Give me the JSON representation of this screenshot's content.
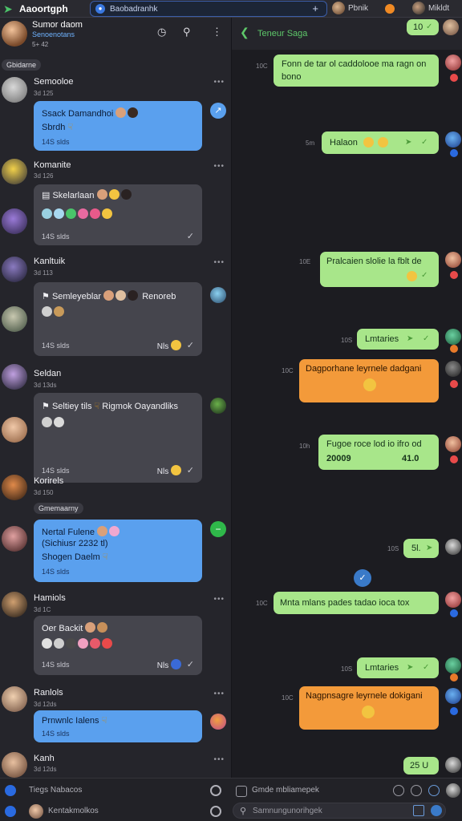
{
  "app": {
    "title": "Aaoortgph",
    "icon": "leaf-icon"
  },
  "tabs": {
    "main_label": "Baobadranhk",
    "plus": "+",
    "user1": "Pbnik",
    "user2": "Mikldt"
  },
  "left_header": {
    "name": "Sumor daom",
    "subtitle": "Senoenotans",
    "meta": "5+ 42"
  },
  "pills": {
    "p1": "Gbidarne",
    "p2": "Gmemaarny"
  },
  "conversations": [
    {
      "name": "Semooloe",
      "meta": "3d  125",
      "bubble": {
        "line1": "Ssack Damandhoi",
        "line2": "Sbrdh",
        "time": "14S  slds"
      }
    },
    {
      "name": "Komanite",
      "meta": "3d  126",
      "bubble": {
        "line1": "Skelarlaan",
        "time": "14S  slds"
      }
    },
    {
      "name": "Kanltuik",
      "meta": "3d  113",
      "bubble": {
        "line1": "Semleyeblar",
        "line1b": "Renoreb",
        "time": "14S  slds",
        "right": "Nls"
      }
    },
    {
      "name": "Seldan",
      "meta": "3d  13ds",
      "bubble": {
        "line1": "Seltiey tils",
        "line1b": "Rigmok Oayandliks",
        "time": "14S  slds",
        "right": "Nls"
      }
    },
    {
      "name": "Korirels",
      "meta": "3d  150",
      "bubble": {
        "line1": "Nertal Fulene",
        "line2": "(Sichiusr 2232 tl)",
        "line3": "Shogen Daelm",
        "time": "14S  slds"
      }
    },
    {
      "name": "Hamiols",
      "meta": "3d  1C",
      "bubble": {
        "line1": "Oer Backit",
        "time": "14S  slds",
        "right": "Nls"
      }
    },
    {
      "name": "Ranlols",
      "meta": "3d  12ds",
      "bubble": {
        "line1": "Prnwnlc Ialens",
        "time": "14S  slds"
      }
    },
    {
      "name": "Kanh",
      "meta": "3d  12ds"
    }
  ],
  "chat": {
    "title": "Teneur Saga",
    "messages": [
      {
        "text": "10",
        "time": ""
      },
      {
        "text": "Fonn de tar ol caddolooe ma ragn on",
        "text2": "bono",
        "time": "10C"
      },
      {
        "text": "Halaon",
        "time": "5m"
      },
      {
        "text": "Pralcaien slolie la fblt de",
        "time": "10E"
      },
      {
        "text": "Lmtaries",
        "time": "10S"
      },
      {
        "text": "Dagporhane leyrnele dadgani",
        "time": "10C"
      },
      {
        "text": "Fugoe roce lod io ifro od",
        "text2a": "20009",
        "text2b": "41.0",
        "time": "10h"
      },
      {
        "text": "5l.",
        "time": "10S"
      },
      {
        "text": "Mnta mlans  pades tadao ioca tox",
        "time": "10C"
      },
      {
        "text": "Lmtaries",
        "time": "10S"
      },
      {
        "text": "Nagpnsagre leyrnele dokigani",
        "time": "10C"
      },
      {
        "text": "25 U",
        "time": ""
      }
    ]
  },
  "bottom": {
    "left1": "Tiegs Nabacos",
    "left2": "Kentakmolkos",
    "center": "Gmde mbliamepek",
    "input_placeholder": "Samnungunorihgek"
  },
  "colors": {
    "accent_green": "#a8e68a",
    "accent_orange": "#f39a3a",
    "accent_blue": "#5aa0ee"
  }
}
